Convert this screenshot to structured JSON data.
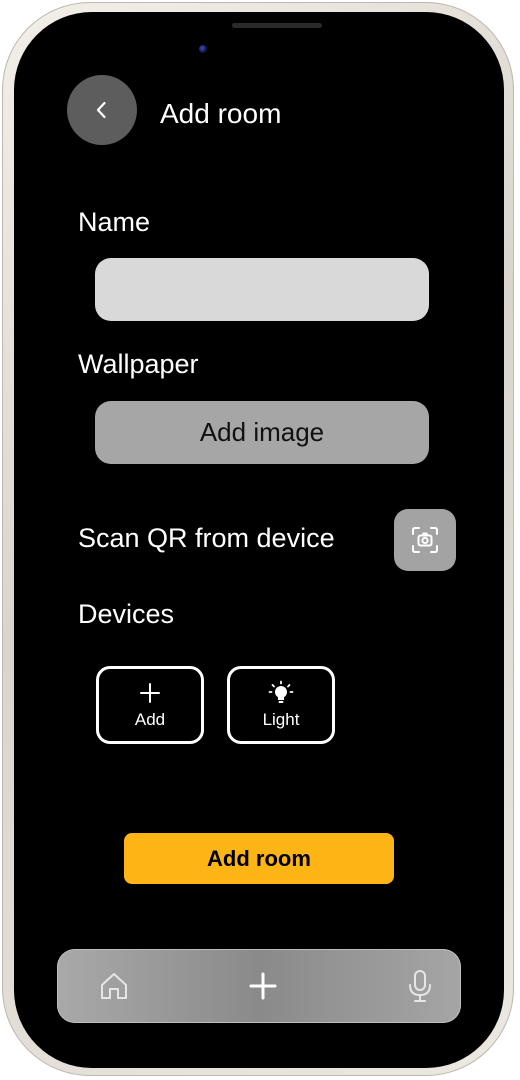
{
  "header": {
    "title": "Add room",
    "back_icon": "chevron-left-icon"
  },
  "form": {
    "name_label": "Name",
    "name_value": "",
    "name_placeholder": "",
    "wallpaper_label": "Wallpaper",
    "add_image_label": "Add image",
    "scan_label": "Scan QR from device",
    "scan_icon": "camera-scan-icon",
    "devices_label": "Devices",
    "devices": [
      {
        "label": "Add",
        "icon": "plus-icon"
      },
      {
        "label": "Light",
        "icon": "light-bulb-icon"
      }
    ],
    "submit_label": "Add room"
  },
  "bottom_nav": {
    "items": [
      {
        "name": "home",
        "icon": "home-icon"
      },
      {
        "name": "add",
        "icon": "plus-icon"
      },
      {
        "name": "voice",
        "icon": "microphone-icon"
      }
    ]
  },
  "colors": {
    "screen_background": "#000000",
    "accent": "#FDB515",
    "input_background": "#D9D9D9",
    "button_gray": "#A6A6A6",
    "back_button": "#5D5D5D"
  }
}
